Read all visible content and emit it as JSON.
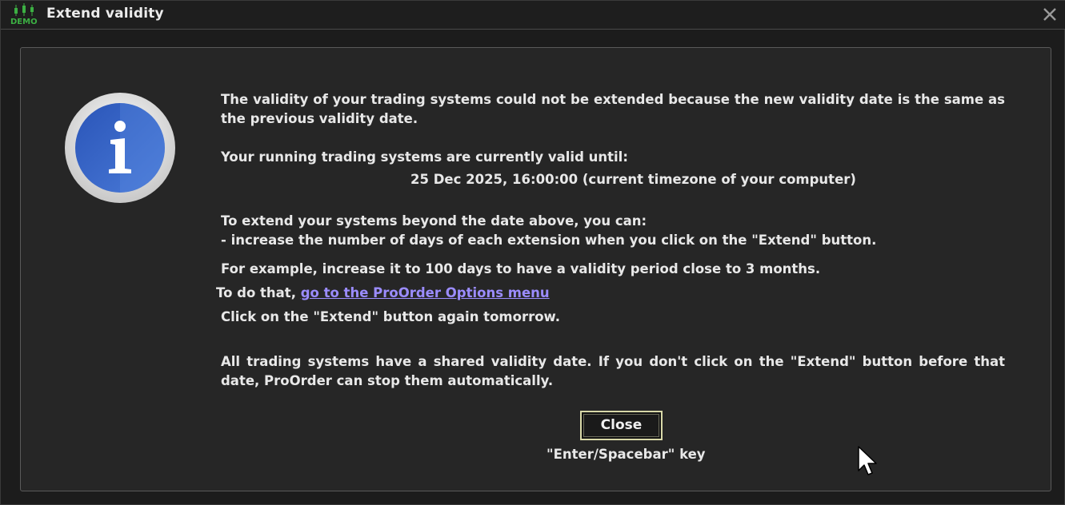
{
  "window": {
    "title": "Extend validity",
    "app_icon": "demo-candlestick-icon",
    "app_icon_label": "DEMO",
    "close_icon": "close-icon"
  },
  "dialog": {
    "icon": "info-icon",
    "paragraph1": "The validity of your trading systems could not be extended because the new validity date is the same as the previous validity date.",
    "valid_until_label": "Your running trading systems are currently valid until:",
    "valid_until_date": "25 Dec 2025, 16:00:00 (current timezone of your computer)",
    "extend_intro": "To extend your systems beyond the date above, you can:",
    "extend_option": "- increase the number of days of each extension when you click on the \"Extend\" button.",
    "example": "For example, increase it to 100 days to have a validity period close to 3 months.",
    "todo_prefix": "To do that, ",
    "todo_link": "go to the ProOrder Options menu",
    "click_again": "Click on the \"Extend\" button again tomorrow.",
    "shared_validity": "All trading systems have a shared validity date. If you don't click on the \"Extend\" button before that date, ProOrder can stop them automatically.",
    "close_button_label": "Close",
    "shortcut_hint": "\"Enter/Spacebar\" key"
  },
  "colors": {
    "link": "#9b8cff",
    "info_blue": "#2f5fc4",
    "demo_green": "#3cb043"
  }
}
